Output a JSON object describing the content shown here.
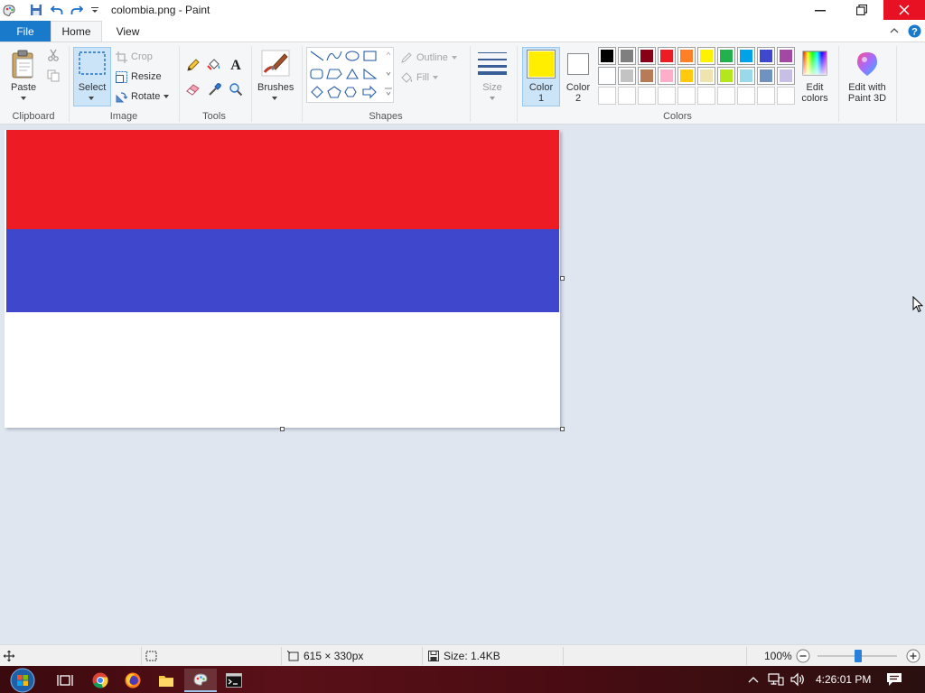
{
  "window": {
    "title": "colombia.png - Paint",
    "minimize_glyph": "—",
    "maximize_glyph": "❐",
    "close_glyph": "✕"
  },
  "tabs": {
    "file": "File",
    "home": "Home",
    "view": "View",
    "collapse_glyph": "^",
    "help_glyph": "?"
  },
  "ribbon": {
    "clipboard": {
      "paste": "Paste",
      "label": "Clipboard"
    },
    "image": {
      "select": "Select",
      "crop": "Crop",
      "resize": "Resize",
      "rotate": "Rotate",
      "label": "Image"
    },
    "tools": {
      "label": "Tools"
    },
    "brushes": {
      "label": "Brushes"
    },
    "shapes": {
      "outline": "Outline",
      "fill": "Fill",
      "label": "Shapes"
    },
    "size": {
      "label": "Size"
    },
    "colors": {
      "color1": "Color\n1",
      "color1_line1": "Color",
      "color1_line2": "1",
      "color2_line1": "Color",
      "color2_line2": "2",
      "edit_line1": "Edit",
      "edit_line2": "colors",
      "paint3d_line1": "Edit with",
      "paint3d_line2": "Paint 3D",
      "label": "Colors",
      "color1_value": "#ffee00",
      "color2_value": "#ffffff",
      "palette_row1": [
        "#000000",
        "#7f7f7f",
        "#880015",
        "#ed1c24",
        "#ff7f27",
        "#fff200",
        "#22b14c",
        "#00a2e8",
        "#3f48cc",
        "#a349a4"
      ],
      "palette_row2": [
        "#ffffff",
        "#c3c3c3",
        "#b97a57",
        "#ffaec9",
        "#ffc90e",
        "#efe4b0",
        "#b5e61d",
        "#99d9ea",
        "#7092be",
        "#c8bfe7"
      ],
      "palette_row3": [
        "",
        "",
        "",
        "",
        "",
        "",
        "",
        "",
        "",
        ""
      ]
    }
  },
  "canvas": {
    "flag_colors": [
      "#ed1c24",
      "#3f48cc",
      "#ffffff"
    ]
  },
  "statusbar": {
    "dimensions": "615 × 330px",
    "size": "Size: 1.4KB",
    "zoom": "100%"
  },
  "taskbar": {
    "time": "4:26:01 PM"
  }
}
